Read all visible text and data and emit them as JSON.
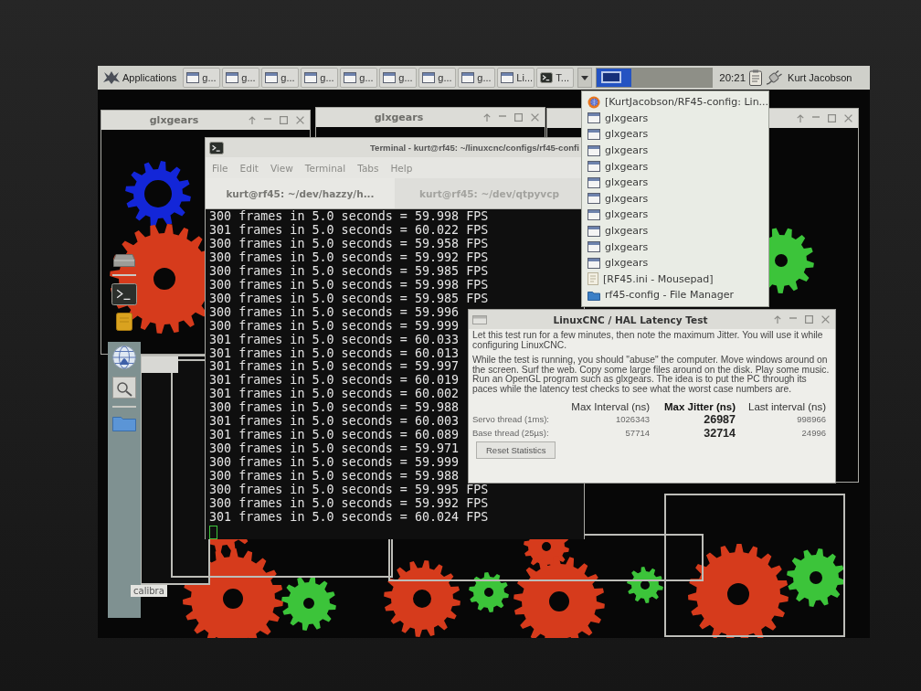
{
  "taskbar": {
    "menu_button": "Applications",
    "tasks": [
      {
        "label": "g...",
        "kind": "window"
      },
      {
        "label": "g...",
        "kind": "window"
      },
      {
        "label": "g...",
        "kind": "window"
      },
      {
        "label": "g...",
        "kind": "window"
      },
      {
        "label": "g...",
        "kind": "window"
      },
      {
        "label": "g...",
        "kind": "window"
      },
      {
        "label": "g...",
        "kind": "window"
      },
      {
        "label": "g...",
        "kind": "window"
      },
      {
        "label": "Li...",
        "kind": "window"
      },
      {
        "label": "T...",
        "kind": "terminal"
      }
    ],
    "clock": "20:21",
    "user": "Kurt Jacobson"
  },
  "window_list_menu": {
    "items": [
      {
        "label": "[KurtJacobson/RF45-config: Lin...",
        "kind": "browser"
      },
      {
        "label": "glxgears",
        "kind": "window"
      },
      {
        "label": "glxgears",
        "kind": "window"
      },
      {
        "label": "glxgears",
        "kind": "window"
      },
      {
        "label": "glxgears",
        "kind": "window"
      },
      {
        "label": "glxgears",
        "kind": "window"
      },
      {
        "label": "glxgears",
        "kind": "window"
      },
      {
        "label": "glxgears",
        "kind": "window"
      },
      {
        "label": "glxgears",
        "kind": "window"
      },
      {
        "label": "glxgears",
        "kind": "window"
      },
      {
        "label": "glxgears",
        "kind": "window"
      },
      {
        "label": "[RF45.ini - Mousepad]",
        "kind": "editor"
      },
      {
        "label": "rf45-config - File Manager",
        "kind": "folder"
      }
    ]
  },
  "gears_windows": [
    {
      "title": "glxgears"
    },
    {
      "title": "glxgears"
    }
  ],
  "dock": {
    "tooltip": "calibra"
  },
  "terminal": {
    "title": "Terminal - kurt@rf45: ~/linuxcnc/configs/rf45-confi",
    "menu": [
      "File",
      "Edit",
      "View",
      "Terminal",
      "Tabs",
      "Help"
    ],
    "tabs": [
      {
        "label": "kurt@rf45: ~/dev/hazzy/h...",
        "selected": true
      },
      {
        "label": "kurt@rf45: ~/dev/qtpyvcp",
        "selected": false
      }
    ],
    "lines": [
      "300 frames in 5.0 seconds = 59.998 FPS",
      "301 frames in 5.0 seconds = 60.022 FPS",
      "300 frames in 5.0 seconds = 59.958 FPS",
      "300 frames in 5.0 seconds = 59.992 FPS",
      "300 frames in 5.0 seconds = 59.985 FPS",
      "300 frames in 5.0 seconds = 59.998 FPS",
      "300 frames in 5.0 seconds = 59.985 FPS",
      "300 frames in 5.0 seconds = 59.996",
      "300 frames in 5.0 seconds = 59.999",
      "301 frames in 5.0 seconds = 60.033",
      "301 frames in 5.0 seconds = 60.013",
      "301 frames in 5.0 seconds = 59.997",
      "301 frames in 5.0 seconds = 60.019",
      "301 frames in 5.0 seconds = 60.002",
      "300 frames in 5.0 seconds = 59.988",
      "301 frames in 5.0 seconds = 60.003",
      "301 frames in 5.0 seconds = 60.089",
      "300 frames in 5.0 seconds = 59.971",
      "300 frames in 5.0 seconds = 59.999",
      "300 frames in 5.0 seconds = 59.988",
      "300 frames in 5.0 seconds = 59.995 FPS",
      "300 frames in 5.0 seconds = 59.992 FPS",
      "301 frames in 5.0 seconds = 60.024 FPS"
    ]
  },
  "latency_test": {
    "title": "LinuxCNC / HAL Latency Test",
    "paragraphs": [
      "Let this test run for a few minutes, then note the maximum Jitter. You will use it while configuring LinuxCNC.",
      "While the test is running, you should \"abuse\" the computer. Move windows around on the screen. Surf the web. Copy some large files around on the disk. Play some music. Run an OpenGL program such as glxgears. The idea is to put the PC through its paces while the latency test checks to see what the worst case numbers are."
    ],
    "columns": [
      {
        "label": "Max Interval (ns)",
        "bold": false
      },
      {
        "label": "Max Jitter (ns)",
        "bold": true
      },
      {
        "label": "Last interval (ns)",
        "bold": false
      }
    ],
    "rows": [
      {
        "label": "Servo thread (1ms):",
        "values": [
          "1026343",
          "26987",
          "998966"
        ]
      },
      {
        "label": "Base thread (25µs):",
        "values": [
          "57714",
          "32714",
          "24996"
        ]
      }
    ],
    "button": "Reset Statistics"
  }
}
